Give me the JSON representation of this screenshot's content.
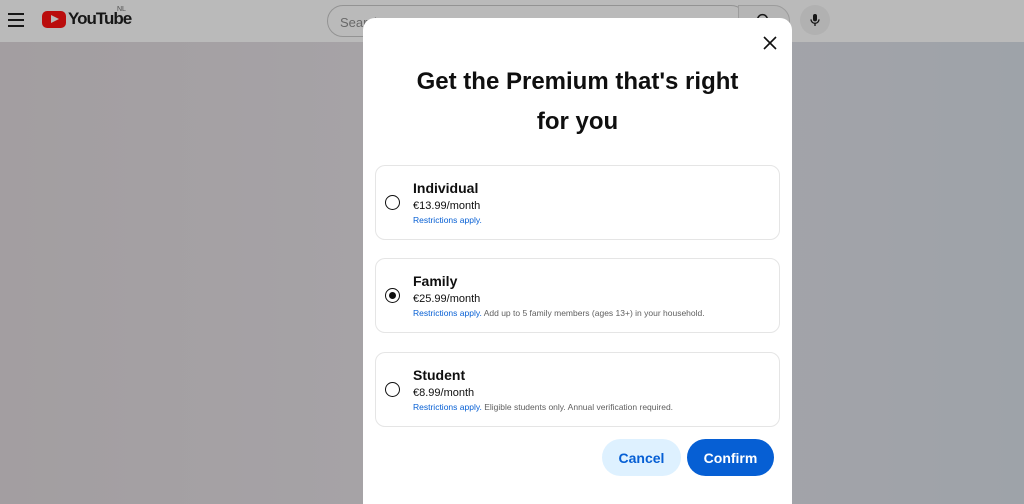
{
  "header": {
    "logo_text": "YouTube",
    "country_code": "NL",
    "search_placeholder": "Search"
  },
  "dialog": {
    "title_line1": "Get the Premium that's right",
    "title_line2": "for you",
    "plans": [
      {
        "name": "Individual",
        "price": "€13.99/month",
        "restrictions": "Restrictions apply.",
        "note": "",
        "selected": false
      },
      {
        "name": "Family",
        "price": "€25.99/month",
        "restrictions": "Restrictions apply.",
        "note": " Add up to 5 family members (ages 13+) in your household.",
        "selected": true
      },
      {
        "name": "Student",
        "price": "€8.99/month",
        "restrictions": "Restrictions apply.",
        "note": " Eligible students only. Annual verification required.",
        "selected": false
      }
    ],
    "cancel_label": "Cancel",
    "confirm_label": "Confirm"
  },
  "colors": {
    "accent": "#065fd4",
    "cancel_bg": "#def1ff",
    "brand_red": "#ff0000"
  },
  "icons": [
    "menu-icon",
    "youtube-logo-icon",
    "search-icon",
    "mic-icon",
    "close-icon"
  ]
}
